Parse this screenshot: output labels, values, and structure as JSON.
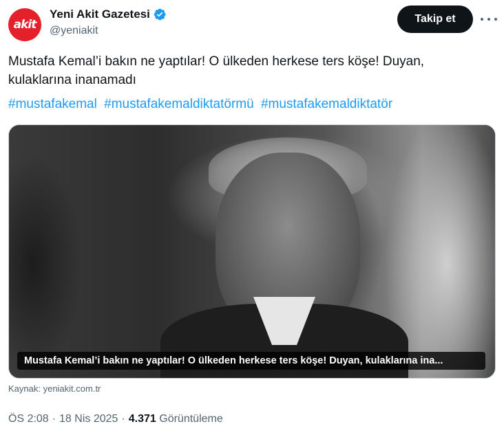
{
  "header": {
    "avatar_text": "akit",
    "display_name": "Yeni Akit Gazetesi",
    "handle": "@yeniakit",
    "follow_label": "Takip et",
    "verified_color": "#1d9bf0",
    "avatar_color": "#e4202a"
  },
  "tweet": {
    "text": "Mustafa Kemal’i bakın ne yaptılar! O ülkeden herkese ters köşe! Duyan, kulaklarına inanamadı",
    "hashtags": [
      "#mustafakemal",
      "#mustafakemaldiktatörmü",
      "#mustafakemaldiktatör"
    ]
  },
  "media": {
    "caption": "Mustafa Kemal’i bakın ne yaptılar! O ülkeden herkese ters köşe! Duyan, kulaklarına ina..."
  },
  "source_text": "Kaynak: yeniakit.com.tr",
  "meta": {
    "time": "ÖS 2:08",
    "dot1": "·",
    "date": "18 Nis 2025",
    "dot2": "·",
    "views_count": "4.371",
    "views_label": "Görüntüleme"
  },
  "icons": {
    "verified": "verified-badge-icon",
    "more": "more-options-icon"
  }
}
